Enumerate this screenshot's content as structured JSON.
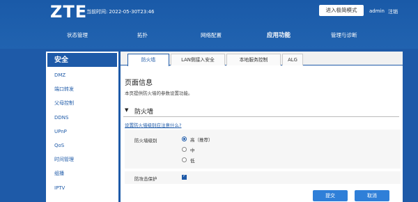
{
  "header": {
    "logo": "ZTE",
    "time_label": "当前时间:",
    "time_value": "2022-05-30T23:46",
    "expert_mode_label": "进入极简模式",
    "user": "admin",
    "logout_label": "注销"
  },
  "menu": {
    "items": [
      {
        "label": "状态管理"
      },
      {
        "label": "拓扑"
      },
      {
        "label": "网络配置"
      },
      {
        "label": "应用功能"
      },
      {
        "label": "管理与诊断"
      }
    ],
    "active": "应用功能"
  },
  "sidebar": {
    "title": "安全",
    "items": [
      {
        "label": "DMZ"
      },
      {
        "label": "端口转发"
      },
      {
        "label": "父母控制"
      },
      {
        "label": "DDNS"
      },
      {
        "label": "UPnP"
      },
      {
        "label": "QoS"
      },
      {
        "label": "时间管理"
      },
      {
        "label": "组播"
      },
      {
        "label": "IPTV"
      }
    ]
  },
  "tabs": {
    "items": [
      {
        "label": "防火墙"
      },
      {
        "label": "LAN侧接入安全"
      },
      {
        "label": "本地服务控制"
      },
      {
        "label": "ALG"
      }
    ],
    "active": "防火墙"
  },
  "page": {
    "title": "页面信息",
    "description": "本页提供防火墙的参数设置功能。",
    "section_title": "防火墙",
    "help_link": "设置防火墙级别应注意什么?"
  },
  "form": {
    "level_label": "防火墙级别",
    "level_options": [
      {
        "label": "高（推荐）",
        "checked": true
      },
      {
        "label": "中",
        "checked": false
      },
      {
        "label": "低",
        "checked": false
      }
    ],
    "antiattack_label": "防攻击保护",
    "antiattack_checked": true
  },
  "buttons": {
    "submit": "提交",
    "cancel": "取消"
  },
  "colors": {
    "brand_blue": "#1e5aa8",
    "button_blue": "#2f7fd8"
  }
}
